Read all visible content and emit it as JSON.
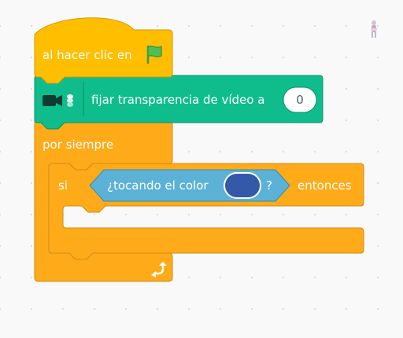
{
  "blocks": {
    "hat": {
      "label": "al hacer clic en",
      "icon": "green-flag-icon"
    },
    "video": {
      "icon": "video-sensing-icon",
      "label": "fijar transparencia de vídeo a",
      "value": "0"
    },
    "forever": {
      "label": "por siempre",
      "loop_icon": "loop-arrow-icon"
    },
    "if": {
      "label": "si",
      "then_label": "entonces",
      "condition": {
        "label": "¿tocando el color",
        "question": "?",
        "color": "#3359a8"
      }
    }
  },
  "colors": {
    "events": "#ffbf00",
    "control": "#ffab19",
    "video": "#0fbd8c",
    "sensing": "#5cb1d6"
  },
  "sprite": {
    "icon": "sprite-thumbnail-icon"
  }
}
